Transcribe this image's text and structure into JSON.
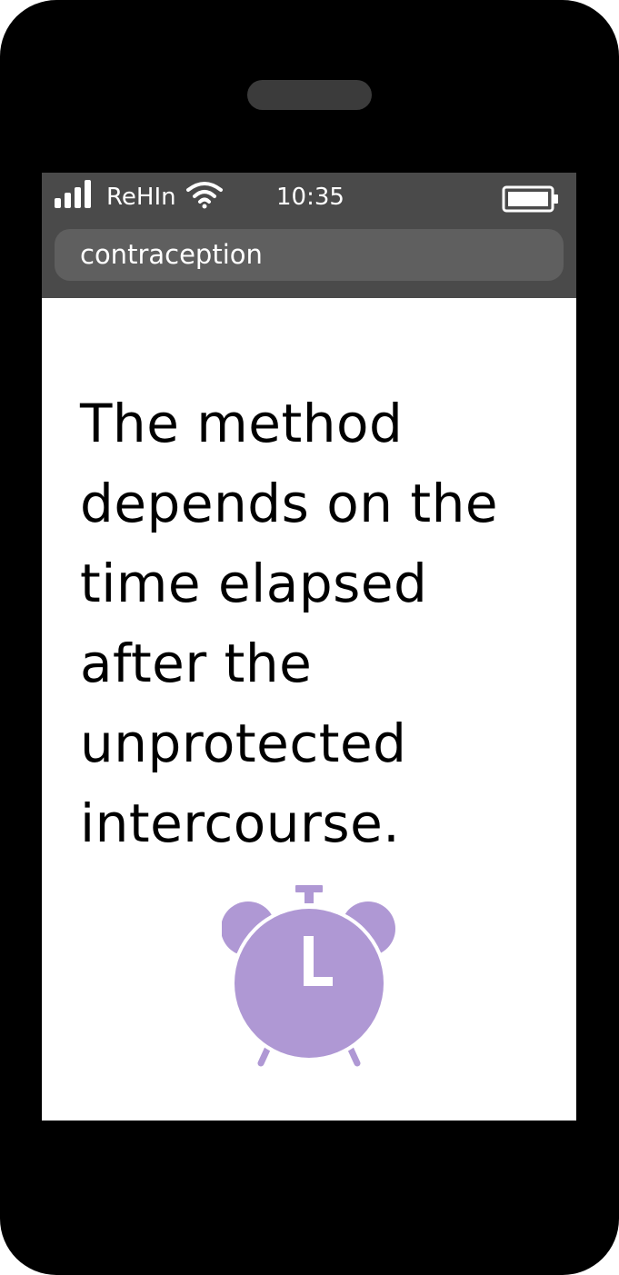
{
  "status_bar": {
    "carrier": "ReHIn",
    "time": "10:35",
    "icons": [
      "signal-bars-icon",
      "wifi-icon",
      "battery-icon"
    ]
  },
  "address_bar": {
    "text": "contraception"
  },
  "content": {
    "headline": "The method depends on the time elapsed after the unprotected intercourse.",
    "illustration": "alarm-clock-icon"
  },
  "colors": {
    "device": "#000000",
    "status_bar": "#4a4a4a",
    "address_bar": "#5f5f5f",
    "page_background": "#ffffff",
    "clock": "#af98d4"
  }
}
